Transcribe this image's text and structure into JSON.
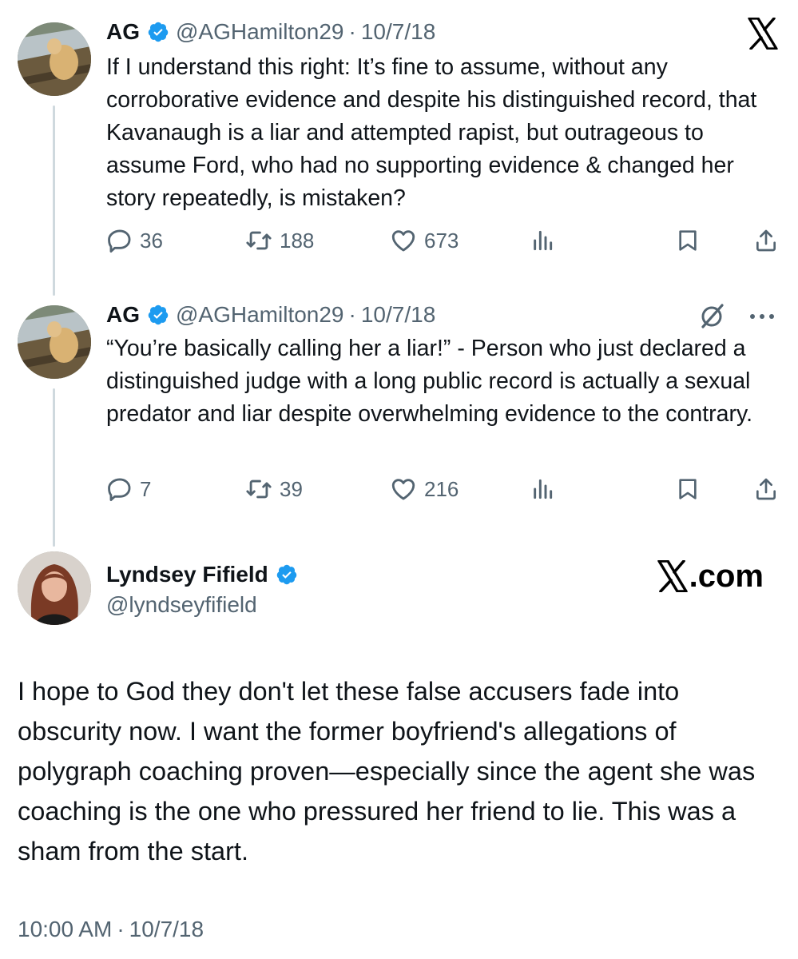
{
  "tweets": [
    {
      "name": "AG",
      "handle": "@AGHamilton29",
      "separator": "·",
      "date": "10/7/18",
      "text": "If I understand this right: It’s fine to assume, without any corroborative evidence and despite his distinguished record, that Kavanaugh is a liar and attempted rapist, but outrageous to assume Ford, who had no supporting evidence & changed her story repeatedly, is mistaken?",
      "replies": "36",
      "reposts": "188",
      "likes": "673"
    },
    {
      "name": "AG",
      "handle": "@AGHamilton29",
      "separator": "·",
      "date": "10/7/18",
      "text": "“You’re basically calling her a liar!” - Person who just declared a distinguished judge with a long public record is actually a sexual predator and liar despite overwhelming evidence to the contrary.",
      "replies": "7",
      "reposts": "39",
      "likes": "216"
    }
  ],
  "main_post": {
    "name": "Lyndsey Fifield",
    "handle": "@lyndseyfifield",
    "brand": ".com",
    "text": "I hope to God they don't let these false accusers fade into obscurity now. I want the former boyfriend's allegations of polygraph coaching proven—especially since the agent she was coaching is the one who pressured her friend to lie. This was a sham from the start.",
    "time": "10:00 AM",
    "separator": "·",
    "date": "10/7/18"
  },
  "colors": {
    "verified_blue": "#1d9bf0",
    "secondary_text": "#536471",
    "primary_text": "#0f1419",
    "thread_line": "#cfd9de"
  }
}
